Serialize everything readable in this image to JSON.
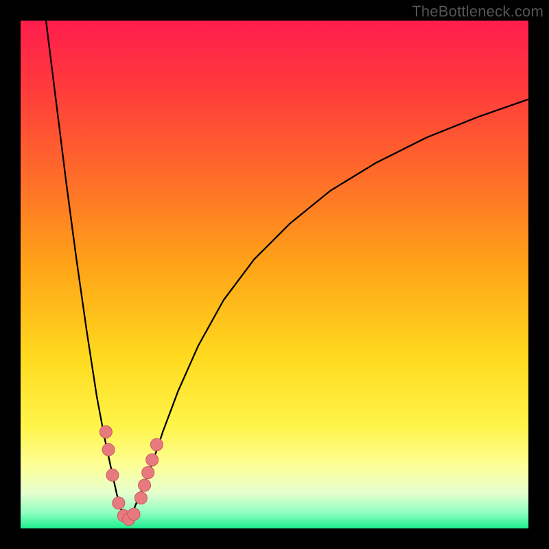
{
  "watermark": "TheBottleneck.com",
  "colors": {
    "gradient_stops": [
      {
        "offset": "0%",
        "color": "#ff1d4d"
      },
      {
        "offset": "13%",
        "color": "#ff3a3c"
      },
      {
        "offset": "30%",
        "color": "#ff6a2a"
      },
      {
        "offset": "48%",
        "color": "#ffa318"
      },
      {
        "offset": "66%",
        "color": "#ffd91e"
      },
      {
        "offset": "80%",
        "color": "#fff54a"
      },
      {
        "offset": "88%",
        "color": "#fdff9b"
      },
      {
        "offset": "93%",
        "color": "#e6ffce"
      },
      {
        "offset": "97%",
        "color": "#8dffc1"
      },
      {
        "offset": "100%",
        "color": "#1dee8c"
      }
    ],
    "curve": "#000000",
    "marker_fill": "#e77a7f",
    "marker_stroke": "#c95a60"
  },
  "chart_data": {
    "type": "line",
    "title": "",
    "xlabel": "",
    "ylabel": "",
    "xlim": [
      0,
      100
    ],
    "ylim": [
      0,
      100
    ],
    "optimum_x": 21,
    "series": [
      {
        "name": "left-branch",
        "x": [
          5,
          7,
          9,
          11,
          13,
          15,
          16.5,
          18,
          19,
          20,
          21
        ],
        "y": [
          100,
          84,
          68,
          53,
          39,
          26,
          18,
          11,
          6.5,
          3,
          1.5
        ]
      },
      {
        "name": "right-branch",
        "x": [
          21,
          22,
          23,
          24.5,
          26,
          28,
          31,
          35,
          40,
          46,
          53,
          61,
          70,
          80,
          90,
          100
        ],
        "y": [
          1.5,
          3,
          5.5,
          9,
          13,
          19,
          27,
          36,
          45,
          53,
          60,
          66.5,
          72,
          77,
          81,
          84.5
        ]
      }
    ],
    "markers": [
      {
        "x": 16.8,
        "y": 19.0
      },
      {
        "x": 17.3,
        "y": 15.5
      },
      {
        "x": 18.1,
        "y": 10.5
      },
      {
        "x": 19.3,
        "y": 5.0
      },
      {
        "x": 20.3,
        "y": 2.5
      },
      {
        "x": 21.3,
        "y": 1.8
      },
      {
        "x": 22.3,
        "y": 2.8
      },
      {
        "x": 23.7,
        "y": 6.0
      },
      {
        "x": 24.4,
        "y": 8.5
      },
      {
        "x": 25.1,
        "y": 11.0
      },
      {
        "x": 25.9,
        "y": 13.5
      },
      {
        "x": 26.8,
        "y": 16.5
      }
    ],
    "marker_radius": 9
  }
}
